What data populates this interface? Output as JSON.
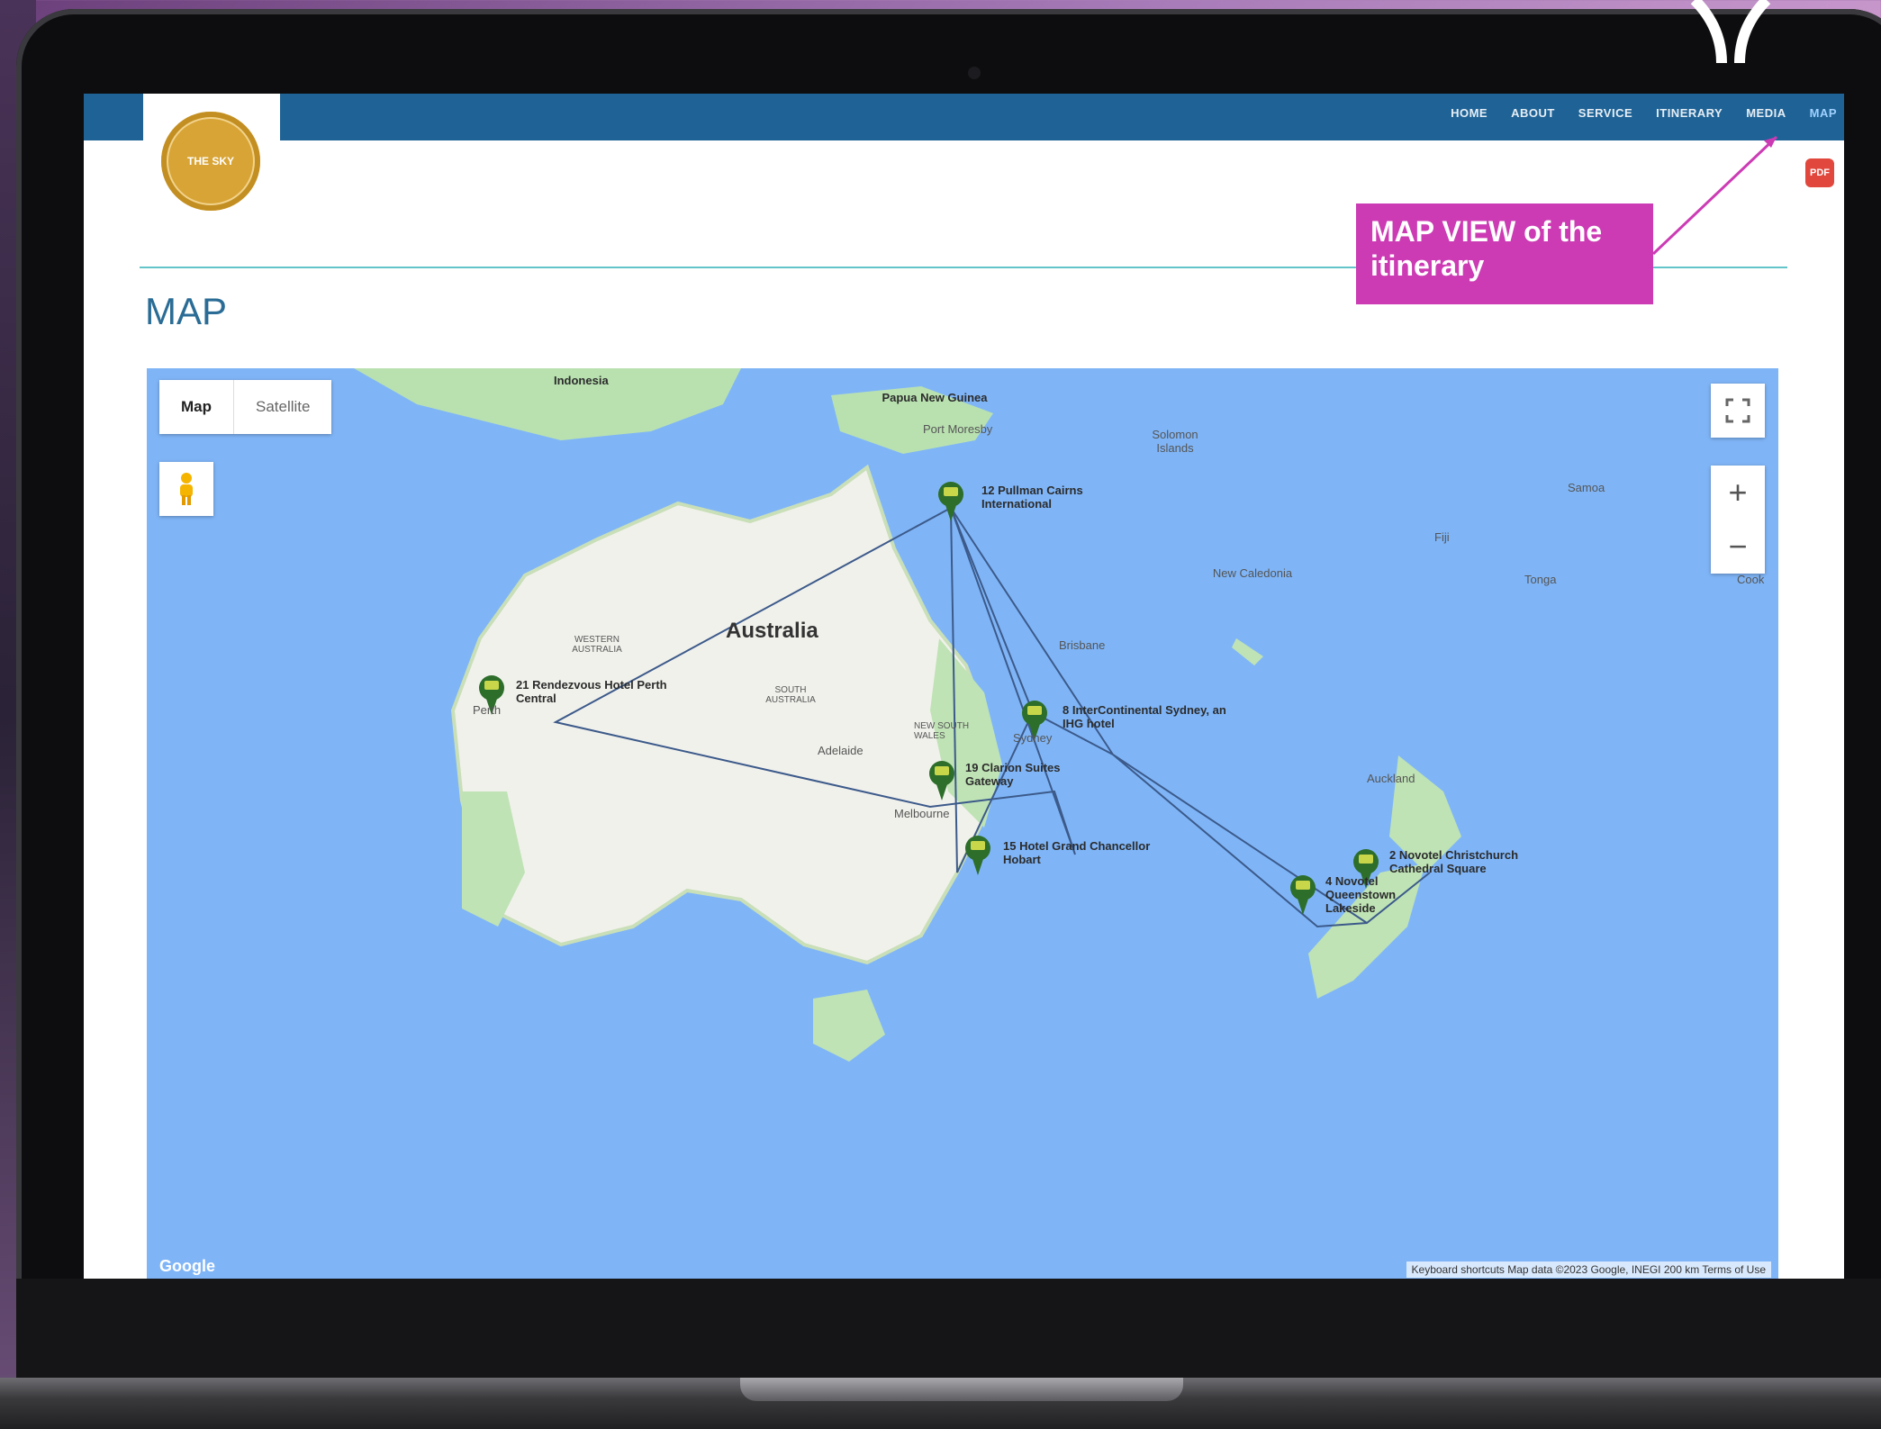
{
  "nav": {
    "items": [
      {
        "label": "HOME"
      },
      {
        "label": "ABOUT"
      },
      {
        "label": "SERVICE"
      },
      {
        "label": "ITINERARY"
      },
      {
        "label": "MEDIA"
      },
      {
        "label": "MAP"
      }
    ]
  },
  "logo": {
    "text": "THE SKY"
  },
  "pdf": {
    "label": "PDF"
  },
  "page": {
    "title": "MAP"
  },
  "callout": {
    "text": "MAP VIEW of the itinerary"
  },
  "map": {
    "type_buttons": {
      "map": "Map",
      "satellite": "Satellite"
    },
    "zoom_in": "+",
    "zoom_out": "−",
    "google_logo": "Google",
    "footer": "Keyboard shortcuts    Map data ©2023 Google, INEGI    200 km    Terms of Use",
    "place_labels": {
      "indonesia": "Indonesia",
      "papua": "Papua New Guinea",
      "port_moresby": "Port Moresby",
      "solomon": "Solomon Islands",
      "australia": "Australia",
      "western_aus": "WESTERN AUSTRALIA",
      "south_aus": "SOUTH AUSTRALIA",
      "nsw": "NEW SOUTH WALES",
      "new_caledonia": "New Caledonia",
      "fiji": "Fiji",
      "samoa": "Samoa",
      "tonga": "Tonga",
      "cook": "Cook",
      "auckland": "Auckland",
      "brisbane": "Brisbane",
      "sydney": "Sydney",
      "melbourne": "Melbourne",
      "adelaide": "Adelaide",
      "perth": "Perth"
    },
    "markers": [
      {
        "label": "12 Pullman Cairns International"
      },
      {
        "label": "21 Rendezvous Hotel Perth Central"
      },
      {
        "label": "8 InterContinental Sydney, an IHG hotel"
      },
      {
        "label": "19 Clarion Suites Gateway"
      },
      {
        "label": "15 Hotel Grand Chancellor Hobart"
      },
      {
        "label": "2 Novotel Christchurch Cathedral Square"
      },
      {
        "label": "4 Novotel Queenstown Lakeside"
      }
    ]
  },
  "colors": {
    "nav_bar": "#1f6396",
    "callout": "#cc3bb4",
    "water": "#7fb5f7",
    "land": "#f1f1ec",
    "marker": "#2d6e2a"
  }
}
